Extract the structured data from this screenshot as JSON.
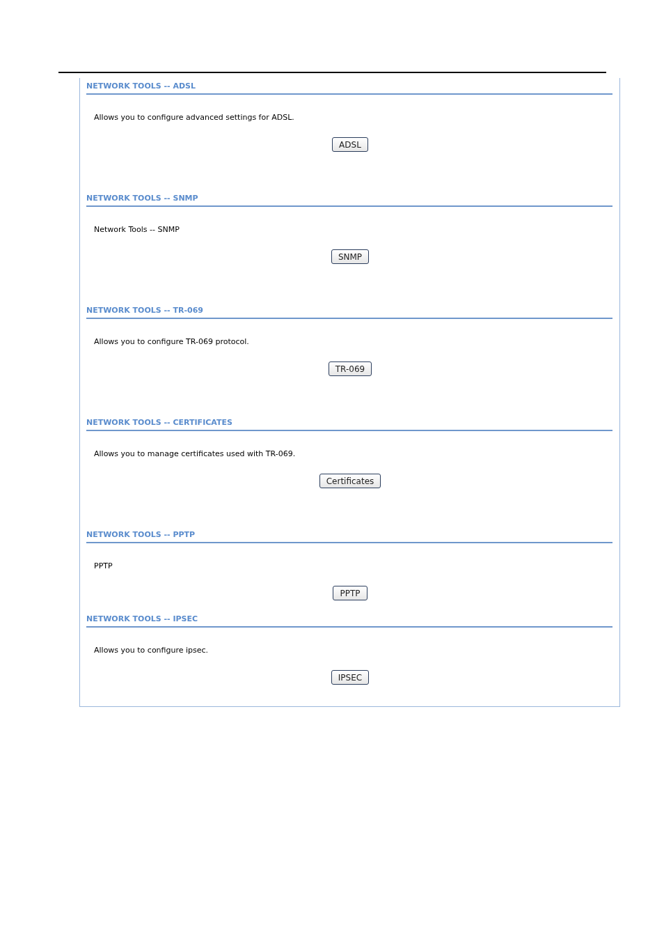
{
  "sections": [
    {
      "heading": "NETWORK TOOLS -- ADSL",
      "description": "Allows you to configure advanced settings for ADSL.",
      "button": "ADSL"
    },
    {
      "heading": "NETWORK TOOLS -- SNMP",
      "description": "Network Tools -- SNMP",
      "button": "SNMP"
    },
    {
      "heading": "NETWORK TOOLS -- TR-069",
      "description": "Allows you to configure TR-069 protocol.",
      "button": "TR-069"
    },
    {
      "heading": "NETWORK TOOLS -- CERTIFICATES",
      "description": "Allows you to manage certificates used with TR-069.",
      "button": "Certificates"
    },
    {
      "heading": "NETWORK TOOLS -- PPTP",
      "description": "PPTP",
      "button": "PPTP"
    },
    {
      "heading": "NETWORK TOOLS -- IPSEC",
      "description": "Allows you to configure ipsec.",
      "button": "IPSEC"
    }
  ]
}
